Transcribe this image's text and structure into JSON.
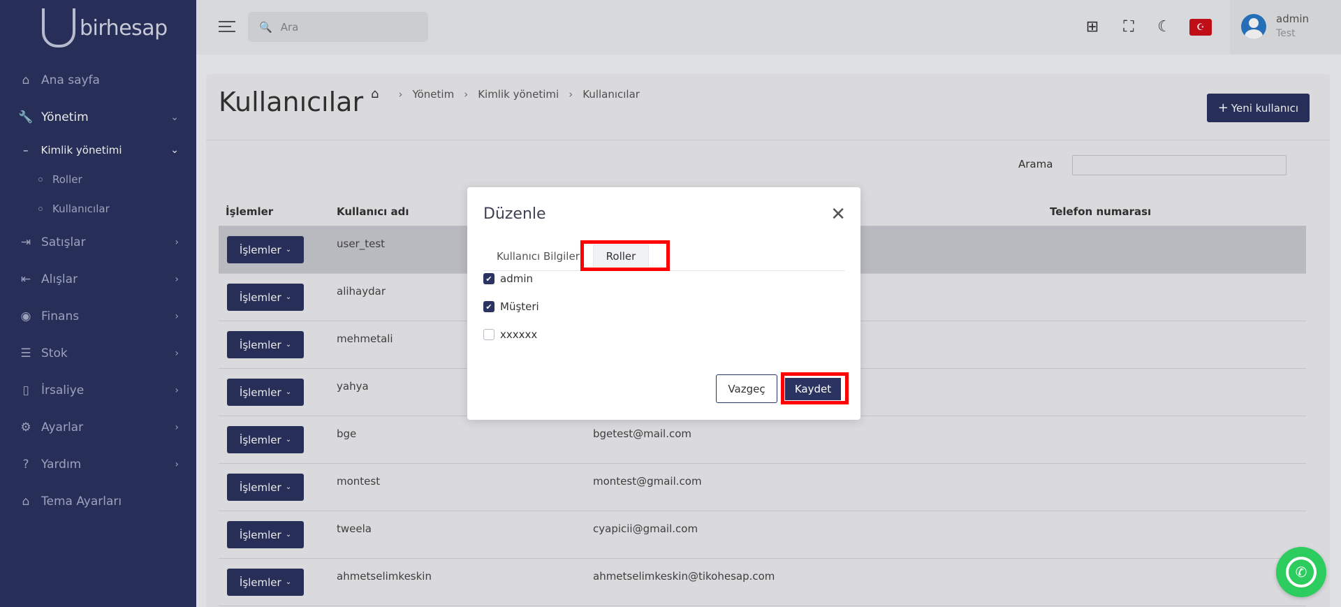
{
  "brand": {
    "name": "birhesap"
  },
  "sidebar": {
    "items": [
      {
        "label": "Ana sayfa",
        "icon": "home-icon"
      },
      {
        "label": "Yönetim",
        "icon": "wrench-icon",
        "active": true
      },
      {
        "label": "Satışlar",
        "icon": "arrow-in-icon"
      },
      {
        "label": "Alışlar",
        "icon": "arrow-out-icon"
      },
      {
        "label": "Finans",
        "icon": "coin-icon"
      },
      {
        "label": "Stok",
        "icon": "list-icon"
      },
      {
        "label": "İrsaliye",
        "icon": "document-icon"
      },
      {
        "label": "Ayarlar",
        "icon": "gear-icon"
      },
      {
        "label": "Yardım",
        "icon": "help-icon"
      },
      {
        "label": "Tema Ayarları",
        "icon": "home-icon"
      }
    ],
    "submenu": {
      "label": "Kimlik yönetimi",
      "children": [
        "Roller",
        "Kullanıcılar"
      ]
    }
  },
  "topbar": {
    "search_placeholder": "Ara",
    "user": {
      "name": "admin",
      "role": "Test"
    }
  },
  "page": {
    "title": "Kullanıcılar",
    "breadcrumb": [
      "Yönetim",
      "Kimlik yönetimi",
      "Kullanıcılar"
    ],
    "new_button": "Yeni kullanıcı",
    "search_label": "Arama"
  },
  "table": {
    "columns": [
      "İşlemler",
      "Kullanıcı adı",
      "",
      "Telefon numarası"
    ],
    "action_label": "İşlemler",
    "rows": [
      {
        "username": "user_test",
        "email": ""
      },
      {
        "username": "alihaydar",
        "email": ""
      },
      {
        "username": "mehmetali",
        "email": ""
      },
      {
        "username": "yahya",
        "email": ""
      },
      {
        "username": "bge",
        "email": "bgetest@mail.com"
      },
      {
        "username": "montest",
        "email": "montest@gmail.com"
      },
      {
        "username": "tweela",
        "email": "cyapicii@gmail.com"
      },
      {
        "username": "ahmetselimkeskin",
        "email": "ahmetselimkeskin@tikohesap.com"
      }
    ]
  },
  "modal": {
    "title": "Düzenle",
    "tabs": [
      "Kullanıcı Bilgileri",
      "Roller"
    ],
    "roles": [
      {
        "label": "admin",
        "checked": true
      },
      {
        "label": "Müşteri",
        "checked": true
      },
      {
        "label": "xxxxxx",
        "checked": false
      }
    ],
    "cancel": "Vazgeç",
    "save": "Kaydet"
  },
  "colors": {
    "primary": "#2b3460",
    "highlight": "#ff0000",
    "whatsapp": "#2ccc5f"
  }
}
